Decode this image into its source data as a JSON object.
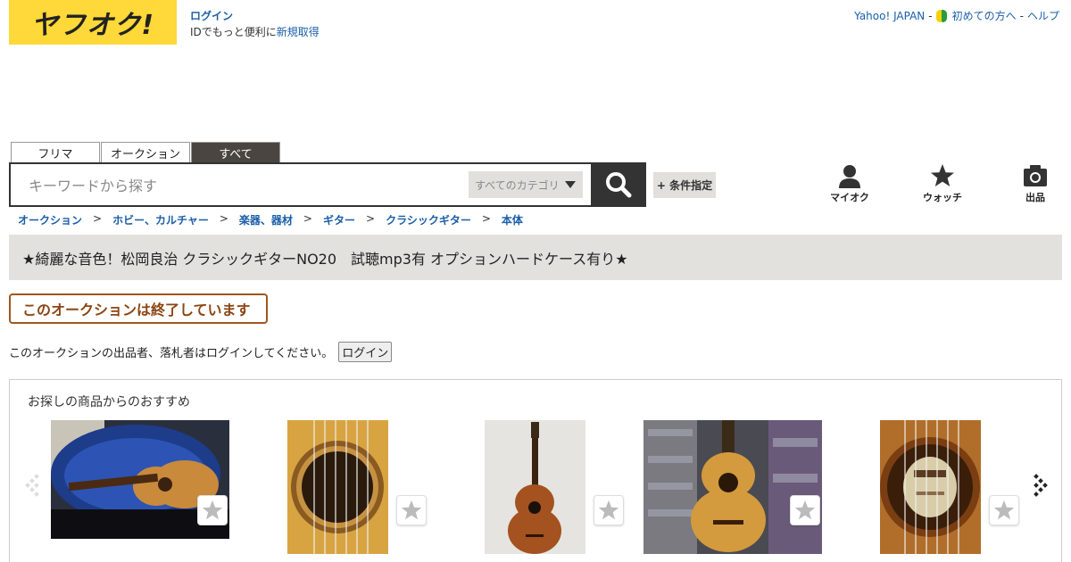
{
  "header": {
    "logo_text": "ヤフオク!",
    "login_label": "ログイン",
    "register_prefix": "IDでもっと便利に",
    "register_link": "新規取得",
    "top_links": {
      "yahoo_japan": "Yahoo! JAPAN",
      "sep1": "-",
      "beginner": "初めての方へ",
      "sep2": "-",
      "help": "ヘルプ"
    }
  },
  "search": {
    "tabs": [
      "フリマ",
      "オークション",
      "すべて"
    ],
    "active_tab": "すべて",
    "placeholder": "キーワードから探す",
    "category_value": "すべてのカテゴリ",
    "condition_label": "+ 条件指定"
  },
  "nav": {
    "my_auction": "マイオク",
    "watch": "ウォッチ",
    "sell": "出品"
  },
  "breadcrumb": [
    "オークション",
    "ホビー、カルチャー",
    "楽器、器材",
    "ギター",
    "クラシックギター",
    "本体"
  ],
  "breadcrumb_sep": ">",
  "item_title": "★綺麗な音色！松岡良治 クラシックギターNO20　試聴mp3有 オプションハードケース有り★",
  "ended_text": "このオークションは終了しています",
  "login_notice": {
    "text": "このオークションの出品者、落札者はログインしてください。",
    "button": "ログイン"
  },
  "recommend": {
    "title": "お探しの商品からのおすすめ",
    "items": [
      {
        "icon": "guitar-in-case-photo"
      },
      {
        "icon": "guitar-soundhole-photo"
      },
      {
        "icon": "guitar-full-photo"
      },
      {
        "icon": "guitar-in-shop-photo"
      },
      {
        "icon": "guitar-label-photo"
      }
    ]
  },
  "colors": {
    "brand_yellow": "#ffd839",
    "link_blue": "#1a5ea8",
    "ended_brown": "#8b4513"
  }
}
